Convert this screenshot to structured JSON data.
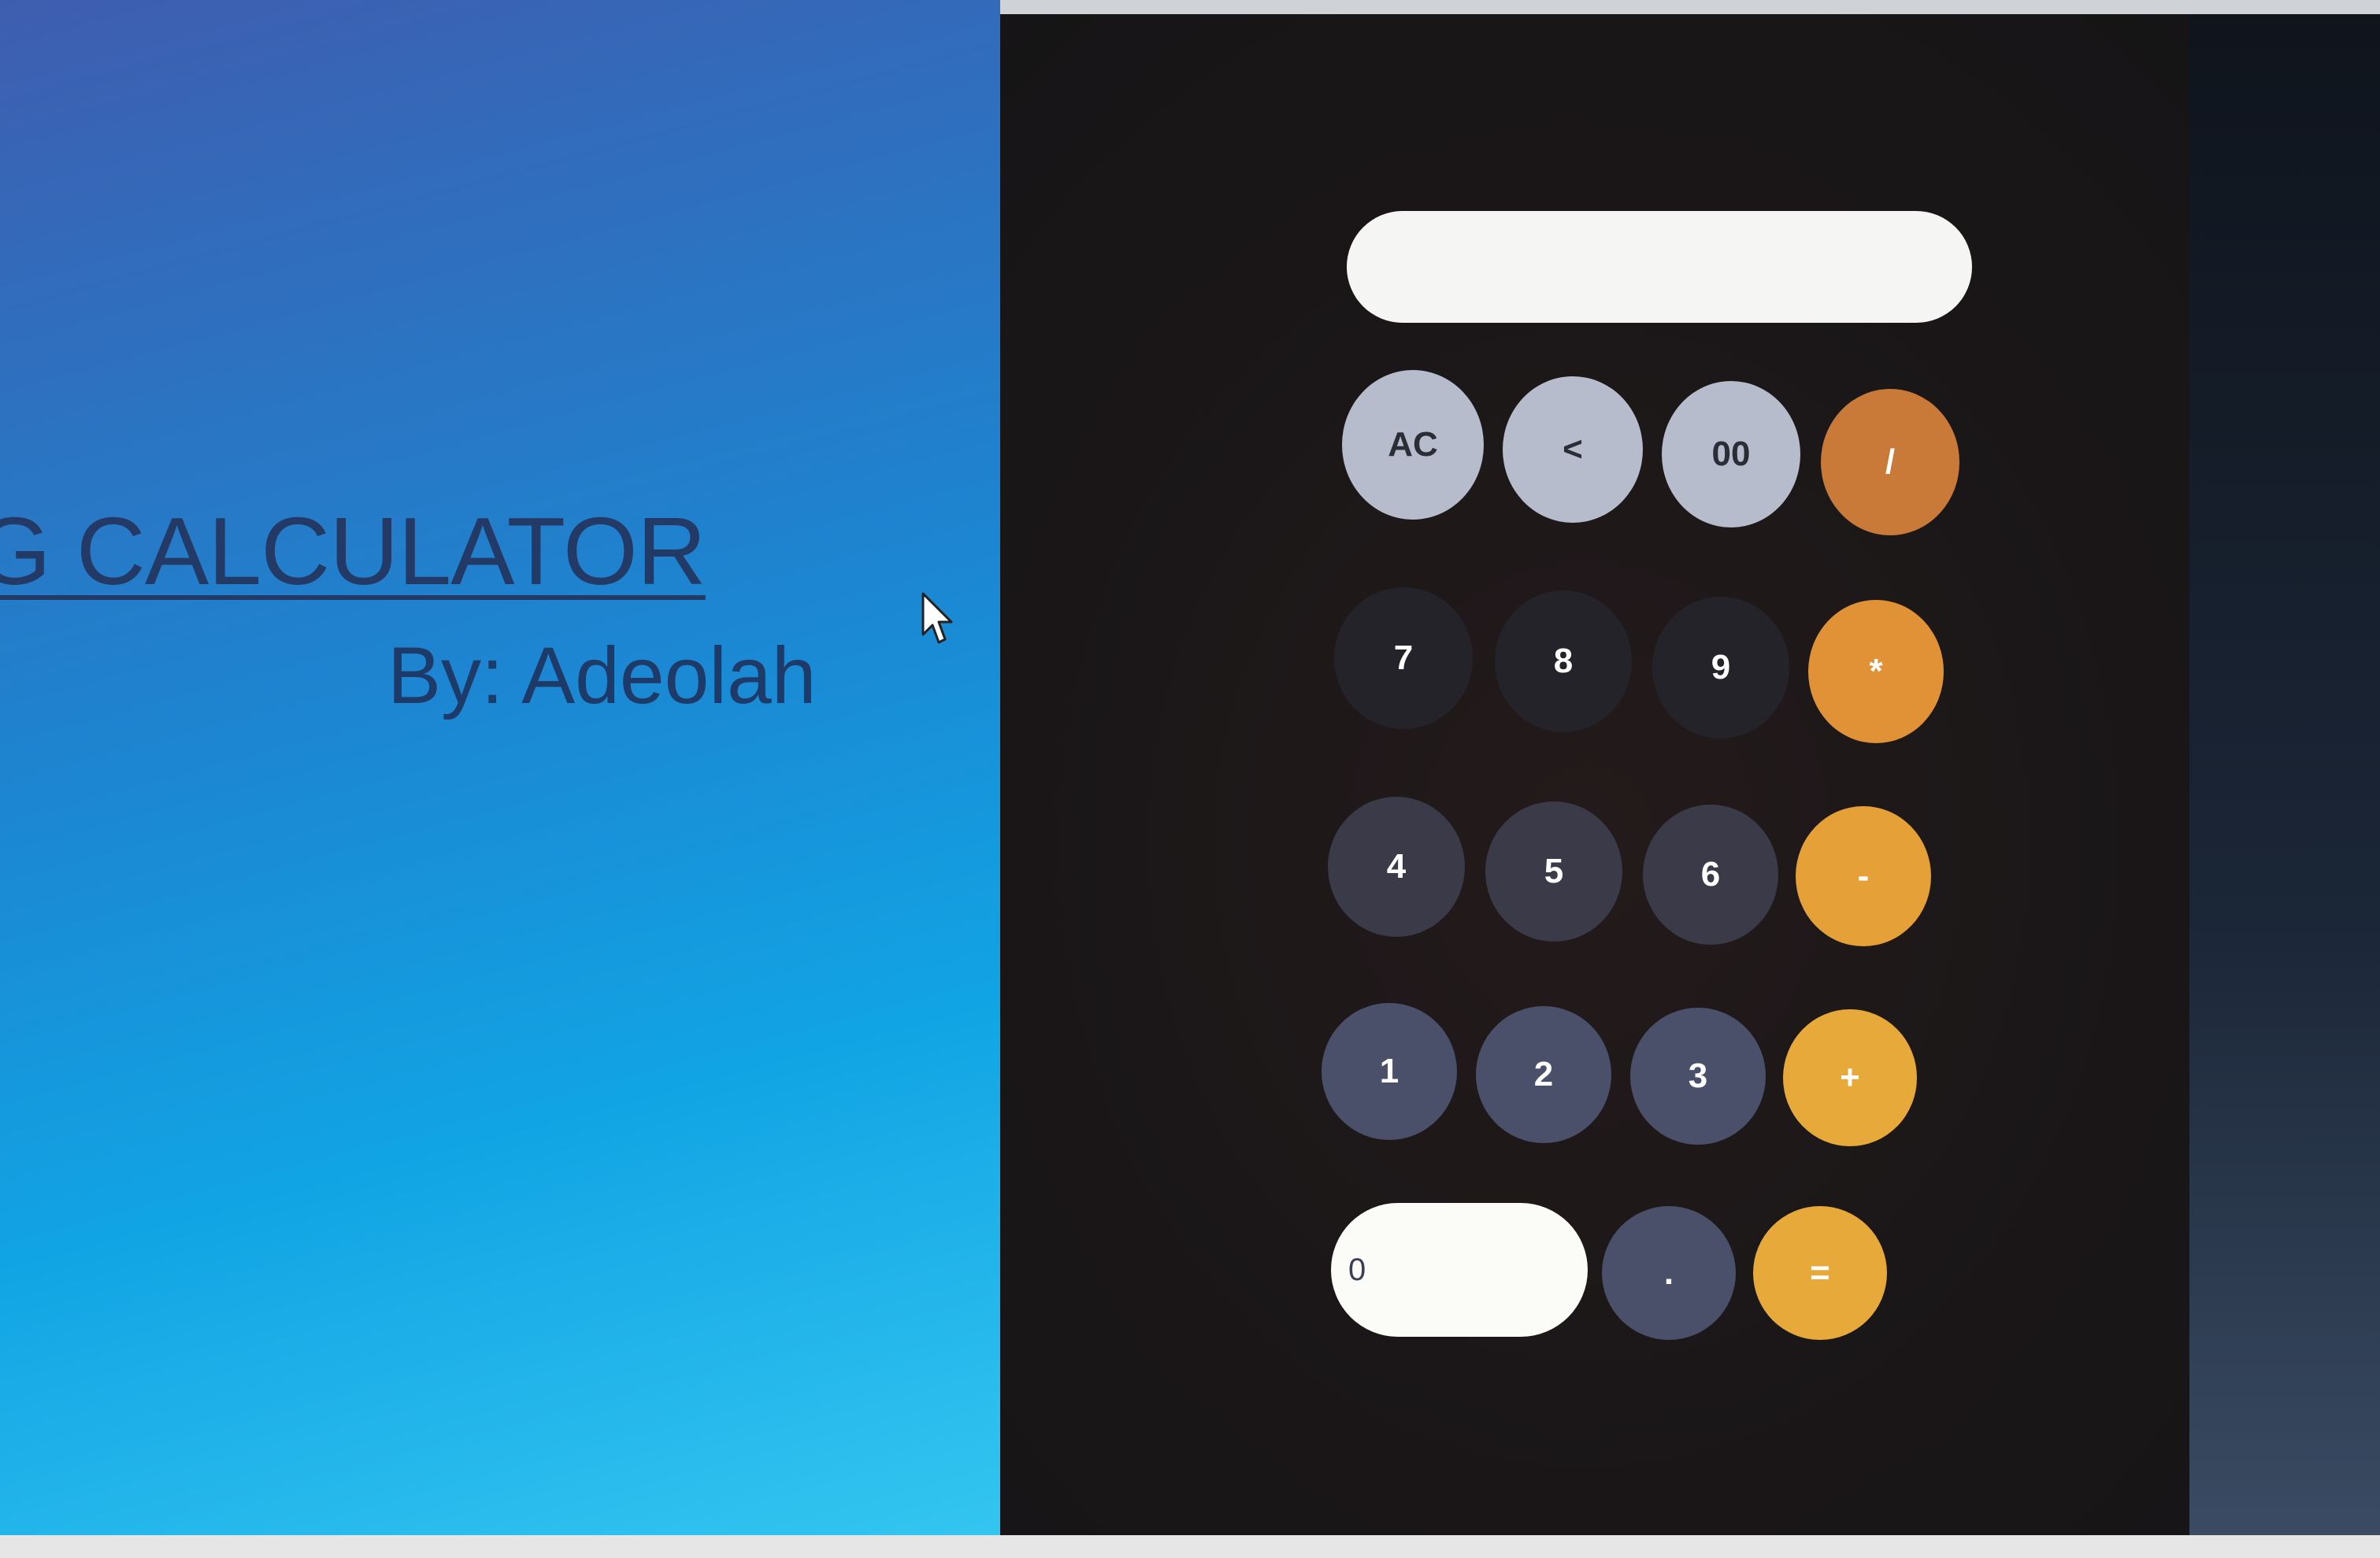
{
  "title": "G CALCULATOR",
  "byline": "By: Adeolah",
  "display": {
    "value": ""
  },
  "keys": {
    "ac": "AC",
    "back": "<",
    "double_zero": "00",
    "divide": "/",
    "seven": "7",
    "eight": "8",
    "nine": "9",
    "multiply": "*",
    "four": "4",
    "five": "5",
    "six": "6",
    "minus": "-",
    "one": "1",
    "two": "2",
    "three": "3",
    "plus": "+",
    "zero": "0",
    "dot": ".",
    "equals": "="
  },
  "icons": {
    "cursor": "mouse-pointer-icon"
  },
  "colors": {
    "accent_orange": "#e6a038",
    "function_key": "#b7bccc",
    "number_key": "#4a4f6a"
  }
}
